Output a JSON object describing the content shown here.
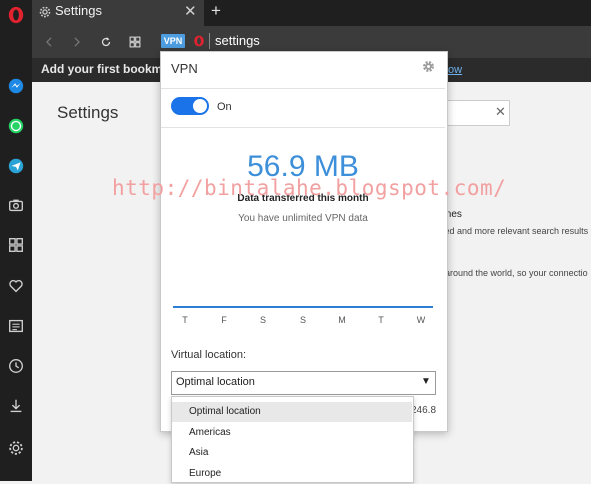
{
  "tab": {
    "title": "Settings",
    "close": "✕",
    "new_tab": "+"
  },
  "address_bar": {
    "vpn_badge": "VPN",
    "url": "settings"
  },
  "bookmarks_bar": {
    "text": "Add your first bookmark",
    "link_text": "ow"
  },
  "settings_page": {
    "title": "Settings",
    "search_clear": "✕",
    "bg_texts": [
      "gines",
      "ized and more relevant search results",
      "s around the world, so your connectio"
    ]
  },
  "vpn_popup": {
    "title": "VPN",
    "toggle_label": "On",
    "toggle_state": "on",
    "data_amount": "56.9 MB",
    "data_caption": "Data transferred this month",
    "unlimited_text": "You have unlimited VPN data",
    "days": [
      "T",
      "F",
      "S",
      "S",
      "M",
      "T",
      "W"
    ],
    "virtual_location_label": "Virtual location:",
    "selected_location": "Optimal location",
    "ip_tail": "246.8",
    "dropdown_options": [
      "Optimal location",
      "Americas",
      "Asia",
      "Europe"
    ]
  },
  "watermark": "http://bintalahe.blogspot.com/",
  "colors": {
    "accent": "#1a73e8",
    "data_amount": "#3d8fd9",
    "sidebar_bg": "#1f1f1f",
    "opera_red": "#e0232e"
  },
  "sidebar_icons": [
    "opera-logo-icon",
    "messenger-icon",
    "whatsapp-icon",
    "telegram-icon",
    "camera-icon",
    "speed-dial-icon",
    "heart-icon",
    "news-icon",
    "history-icon",
    "download-icon",
    "settings-icon"
  ]
}
